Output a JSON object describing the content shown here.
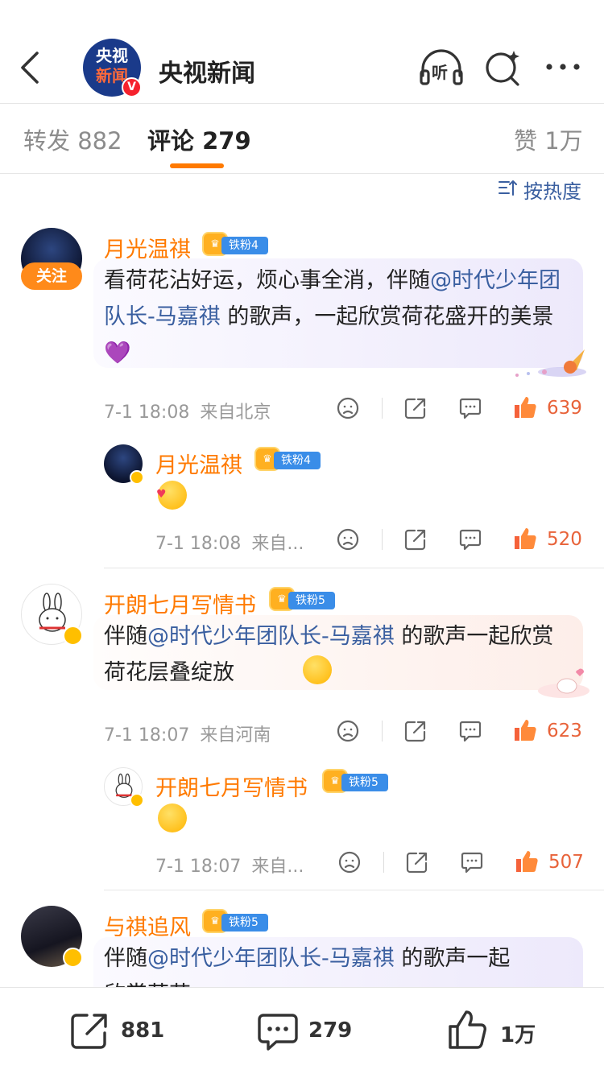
{
  "header": {
    "title": "央视新闻",
    "logo_line1": "央视",
    "logo_line2": "新闻",
    "listen_label": "听"
  },
  "tabs": {
    "repost_label": "转发",
    "repost_count": "882",
    "comment_label": "评论",
    "comment_count": "279",
    "like_label": "赞",
    "like_count": "1万"
  },
  "sort_label": "按热度",
  "follow_label": "关注",
  "comments": [
    {
      "user": "月光温祺",
      "fan_badge": "铁粉4",
      "text_before": "看荷花沾好运，烦心事全消，伴随",
      "mention": "@时代少年团队长-马嘉祺",
      "text_after": " 的歌声，一起欣赏荷花盛开的美景",
      "emoji": "💜",
      "time": "7-1 18:08",
      "source": "来自北京",
      "likes": "639",
      "reply": {
        "user": "月光温祺",
        "fan_badge": "铁粉4",
        "time": "7-1 18:08",
        "source": "来自...",
        "likes": "520"
      }
    },
    {
      "user": "开朗七月写情书",
      "fan_badge": "铁粉5",
      "text_before": "伴随",
      "mention": "@时代少年团队长-马嘉祺",
      "text_after": " 的歌声一起欣赏荷花层叠绽放",
      "time": "7-1 18:07",
      "source": "来自河南",
      "likes": "623",
      "reply": {
        "user": "开朗七月写情书",
        "fan_badge": "铁粉5",
        "time": "7-1 18:07",
        "source": "来自...",
        "likes": "507"
      }
    },
    {
      "user": "与祺追风",
      "fan_badge": "铁粉5",
      "text_before": "伴随",
      "mention": "@时代少年团队长-马嘉祺",
      "text_after": " 的歌声一起",
      "text_line2": "欣赏荷花"
    }
  ],
  "bottom_bar": {
    "repost_count": "881",
    "comment_count": "279",
    "like_count": "1万"
  },
  "colors": {
    "accent": "#ff7a00",
    "mention": "#3a5fa0",
    "like": "#e8633a",
    "badge_blue": "#3a8de8",
    "verified": "#ffbf00"
  }
}
